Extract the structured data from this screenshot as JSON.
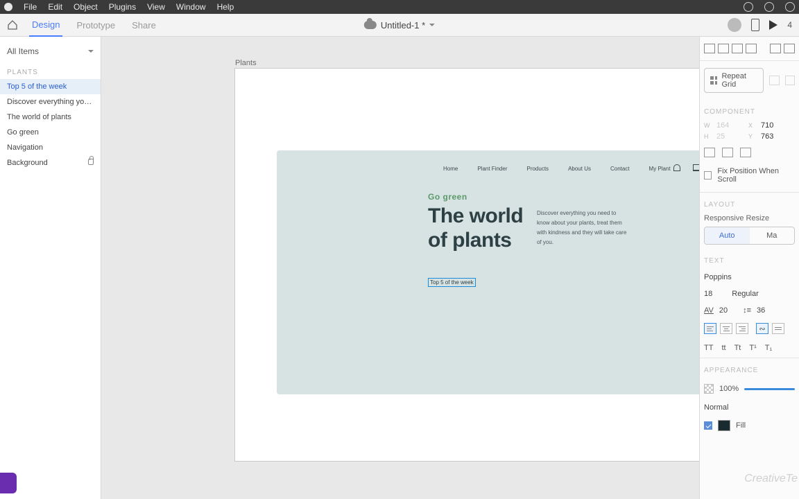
{
  "menubar": {
    "items": [
      "File",
      "Edit",
      "Object",
      "Plugins",
      "View",
      "Window",
      "Help"
    ]
  },
  "toolbar": {
    "tabs": {
      "design": "Design",
      "prototype": "Prototype",
      "share": "Share"
    },
    "doc_title": "Untitled-1 *",
    "zoom": "4"
  },
  "left_panel": {
    "filter": "All Items",
    "section": "PLANTS",
    "items": [
      "Top 5 of the week",
      "Discover everything you n...",
      "The world of plants",
      "Go green",
      "Navigation",
      "Background"
    ]
  },
  "canvas": {
    "artboard_name": "Plants",
    "mock": {
      "nav": [
        "Home",
        "Plant Finder",
        "Products",
        "About Us",
        "Contact",
        "My Plant"
      ],
      "tagline": "Go green",
      "headline": "The world\nof plants",
      "desc": "Discover everything you need to know about your plants, treat them with kindness and they will take care of you.",
      "selected_text": "Top 5 of the week"
    }
  },
  "inspector": {
    "repeat_label": "Repeat Grid",
    "component": "COMPONENT",
    "w": "164",
    "x": "710",
    "h": "25",
    "y": "763",
    "fix_label": "Fix Position When Scroll",
    "layout": "LAYOUT",
    "resp": "Responsive Resize",
    "auto": "Auto",
    "manual": "Ma",
    "text": "TEXT",
    "font": "Poppins",
    "size": "18",
    "weight": "Regular",
    "tracking": "20",
    "leading": "36",
    "case": [
      "TT",
      "tt",
      "Tt",
      "T¹",
      "T₁"
    ],
    "appearance": "APPEARANCE",
    "opacity": "100%",
    "blend": "Normal",
    "fill": "Fill"
  },
  "watermark": "CreativeTe"
}
